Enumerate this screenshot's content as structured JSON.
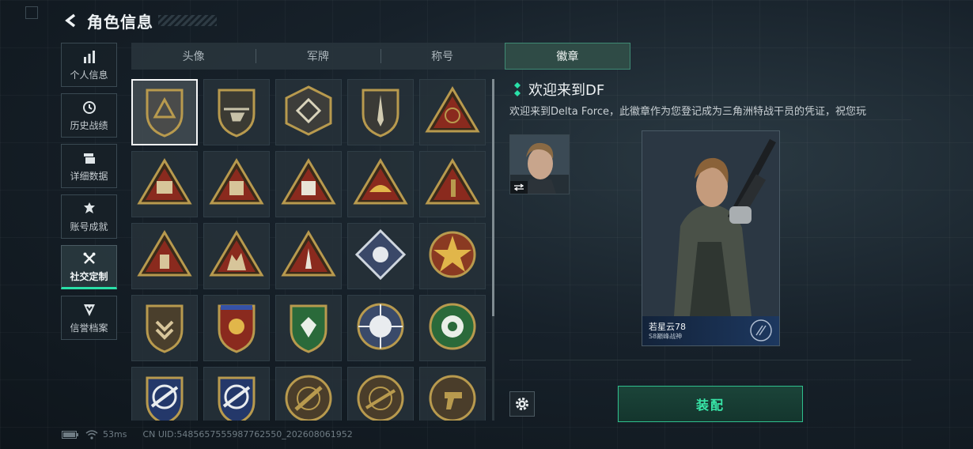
{
  "header": {
    "title": "角色信息"
  },
  "sidebar": {
    "items": [
      {
        "label": "个人信息",
        "icon": "bar-chart-icon"
      },
      {
        "label": "历史战绩",
        "icon": "history-clock-icon"
      },
      {
        "label": "详细数据",
        "icon": "folder-icon"
      },
      {
        "label": "账号成就",
        "icon": "achievement-icon"
      },
      {
        "label": "社交定制",
        "icon": "tools-icon",
        "active": true
      },
      {
        "label": "信誉档案",
        "icon": "shield-chevron-icon"
      }
    ]
  },
  "tabs": [
    {
      "label": "头像"
    },
    {
      "label": "军牌"
    },
    {
      "label": "称号"
    },
    {
      "label": "徽章",
      "active": true
    }
  ],
  "badges": [
    "triangle-emblem-badge",
    "helicopter-badge",
    "diamond-emblem-badge",
    "dagger-shield-badge",
    "gyro-triangle-badge",
    "s4-triangle-badge",
    "s7-triangle-badge",
    "s8-triangle-badge",
    "helmet-triangle-badge",
    "number-one-triangle-badge",
    "flashdrive-triangle-badge",
    "soldiers-triangle-badge",
    "rocket-triangle-badge",
    "rose-diamond-badge",
    "star-skull-badge",
    "chevron-shield-badge",
    "winged-star-shield-badge",
    "green-gem-shield-badge",
    "skull-crosshair-badge",
    "green-floral-badge",
    "rifle-crosshair-shield-badge",
    "rifle-crosshair-shield-badge-2",
    "rifle-round-shield-badge",
    "sniper-round-shield-badge",
    "pistol-round-shield-badge"
  ],
  "detail": {
    "title": "欢迎来到DF",
    "description": "欢迎来到Delta Force，此徽章作为您登记成为三角洲特战干员的凭证，祝您玩",
    "card": {
      "name": "若星云78",
      "subtitle": "S8巅峰战神"
    }
  },
  "actions": {
    "equip_label": "装配"
  },
  "status": {
    "ping": "53ms",
    "uid": "CN UID:5485657555987762550_202608061952"
  },
  "colors": {
    "accent": "#29e0a8",
    "gold": "#b89a4e",
    "tab_active": "#2f4b46"
  }
}
